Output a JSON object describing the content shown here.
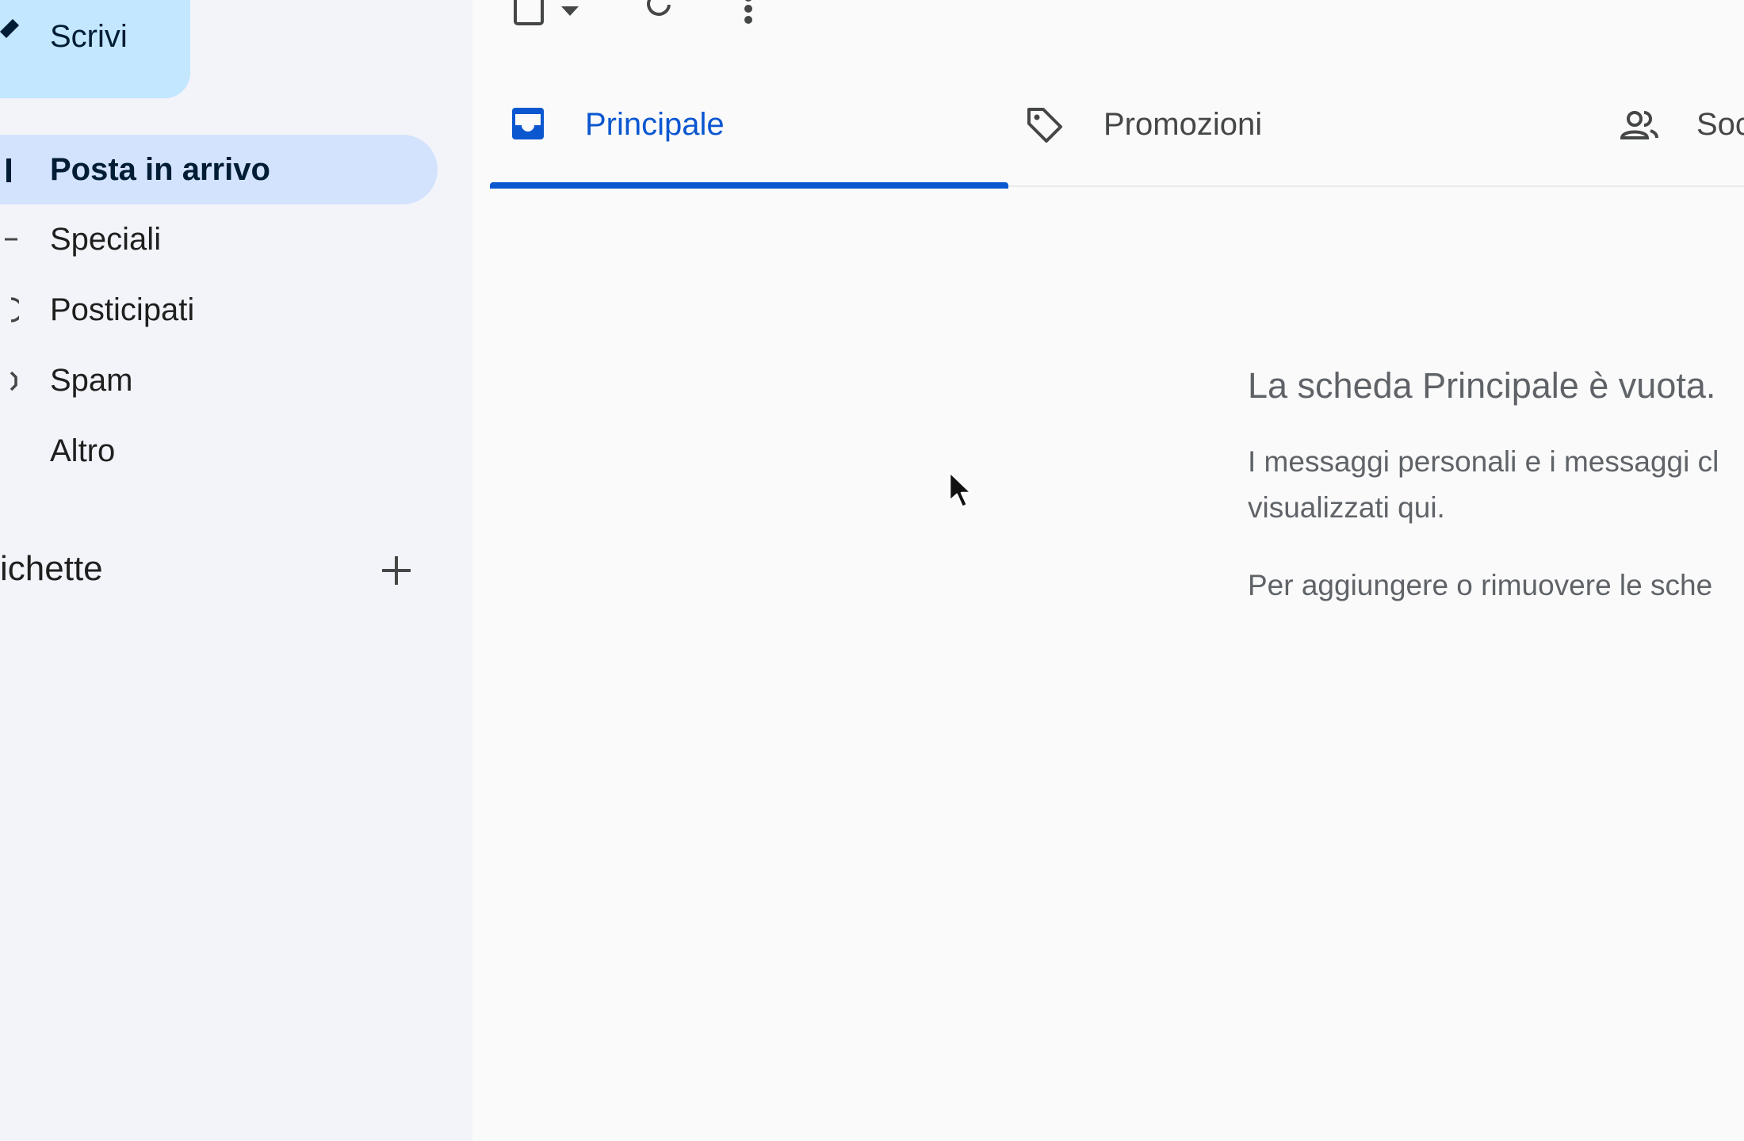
{
  "sidebar": {
    "compose_label": "Scrivi",
    "items": [
      {
        "label": "Posta in arrivo",
        "icon": "inbox-icon",
        "active": true
      },
      {
        "label": "Speciali",
        "icon": "star-icon",
        "active": false
      },
      {
        "label": "Posticipati",
        "icon": "clock-icon",
        "active": false
      },
      {
        "label": "Spam",
        "icon": "spam-icon",
        "active": false
      },
      {
        "label": "Altro",
        "icon": "chevron-down-icon",
        "active": false
      }
    ],
    "labels_heading": "ichette"
  },
  "toolbar": {
    "icons": [
      "checkbox-icon",
      "dropdown-arrow-icon",
      "refresh-icon",
      "more-vert-icon"
    ]
  },
  "tabs": [
    {
      "label": "Principale",
      "icon": "inbox-tab-icon",
      "active": true
    },
    {
      "label": "Promozioni",
      "icon": "tag-icon",
      "active": false
    },
    {
      "label": "Soc",
      "icon": "people-icon",
      "active": false
    }
  ],
  "empty_state": {
    "title": "La scheda Principale è vuota.",
    "line1": "I messaggi personali e i messaggi cl",
    "line2": "visualizzati qui.",
    "line3": "Per aggiungere o rimuovere le sche"
  },
  "colors": {
    "accent": "#0b57d0",
    "compose_bg": "#c2e7ff",
    "active_nav_bg": "#d3e3fd",
    "sidebar_bg": "#f3f4f9"
  }
}
